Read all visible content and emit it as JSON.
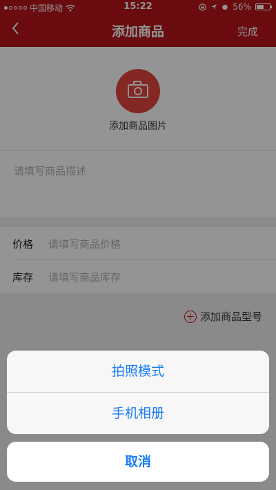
{
  "status_bar": {
    "carrier": "中国移动",
    "time": "15:22",
    "battery_text": "56%",
    "battery_level": 0.56,
    "icons": [
      "signal-dots-icon",
      "wifi-icon",
      "lock-rotation-icon",
      "location-arrow-icon",
      "alarm-icon",
      "battery-icon"
    ]
  },
  "nav": {
    "back_icon": "chevron-left-icon",
    "title": "添加商品",
    "done": "完成"
  },
  "photo": {
    "icon": "camera-icon",
    "label": "添加商品图片"
  },
  "description": {
    "placeholder": "请填写商品描述"
  },
  "form": {
    "price_label": "价格",
    "price_placeholder": "请填写商品价格",
    "stock_label": "库存",
    "stock_placeholder": "请填写商品库存"
  },
  "add_model": {
    "icon": "plus-circle-icon",
    "label": "添加商品型号"
  },
  "action_sheet": {
    "options": [
      "拍照模式",
      "手机相册"
    ],
    "cancel": "取消"
  },
  "colors": {
    "brand_red": "#b5141b",
    "camera_red": "#e2463d",
    "action_blue": "#1a7cf5"
  }
}
